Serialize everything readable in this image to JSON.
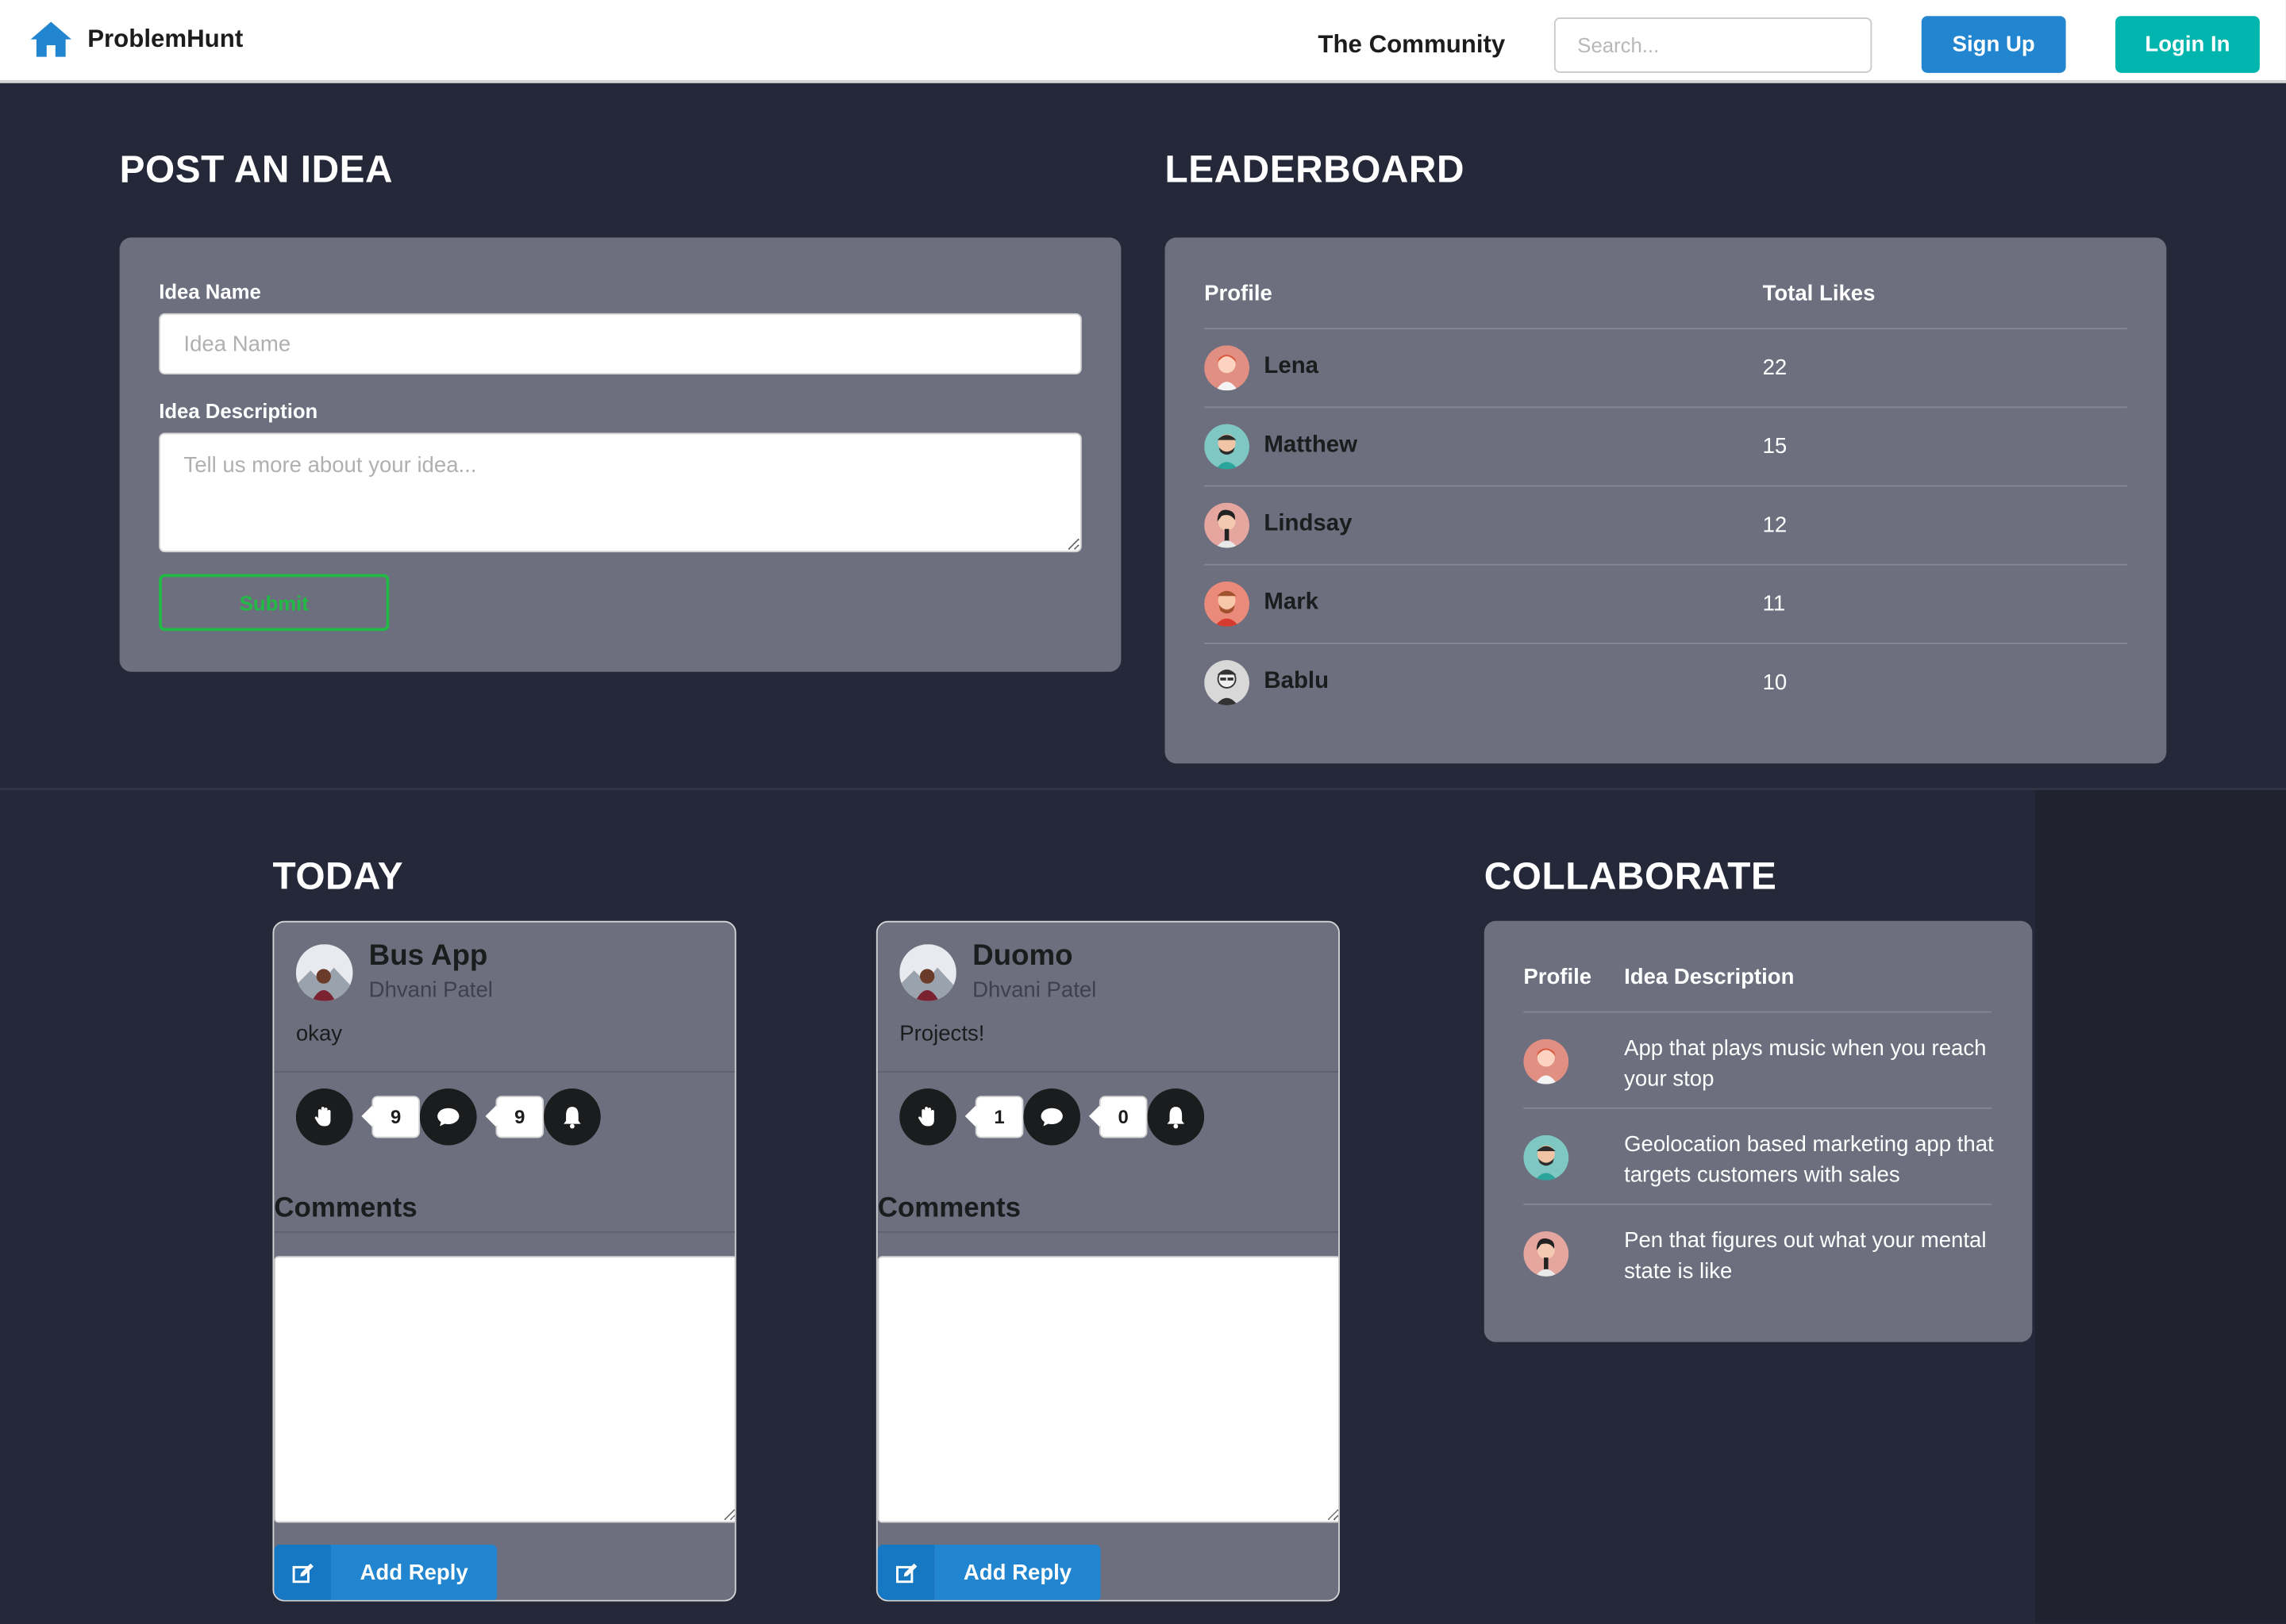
{
  "nav": {
    "brand": "ProblemHunt",
    "community": "The Community",
    "search_placeholder": "Search...",
    "signup_label": "Sign Up",
    "login_label": "Login In"
  },
  "post": {
    "title": "POST AN IDEA",
    "name_label": "Idea Name",
    "name_placeholder": "Idea Name",
    "desc_label": "Idea Description",
    "desc_placeholder": "Tell us more about your idea...",
    "submit_label": "Submit"
  },
  "leaderboard": {
    "title": "LEADERBOARD",
    "col_profile": "Profile",
    "col_likes": "Total Likes",
    "rows": [
      {
        "name": "Lena",
        "likes": "22"
      },
      {
        "name": "Matthew",
        "likes": "15"
      },
      {
        "name": "Lindsay",
        "likes": "12"
      },
      {
        "name": "Mark",
        "likes": "11"
      },
      {
        "name": "Bablu",
        "likes": "10"
      }
    ]
  },
  "today": {
    "title": "TODAY",
    "cards": [
      {
        "title": "Bus App",
        "author": "Dhvani Patel",
        "description": "okay",
        "likes": "9",
        "comments": "9",
        "comments_heading": "Comments",
        "reply_label": "Add Reply"
      },
      {
        "title": "Duomo",
        "author": "Dhvani Patel",
        "description": "Projects!",
        "likes": "1",
        "comments": "0",
        "comments_heading": "Comments",
        "reply_label": "Add Reply"
      }
    ]
  },
  "collaborate": {
    "title": "COLLABORATE",
    "col_profile": "Profile",
    "col_desc": "Idea Description",
    "rows": [
      {
        "description": "App that plays music when you reach your stop"
      },
      {
        "description": "Geolocation based marketing app that targets customers with sales"
      },
      {
        "description": "Pen that figures out what your mental state is like"
      }
    ]
  },
  "colors": {
    "background": "#252839",
    "panel": "#6d6f7e",
    "primary_blue": "#2185d0",
    "teal": "#00b5ad",
    "green": "#21ba45"
  }
}
